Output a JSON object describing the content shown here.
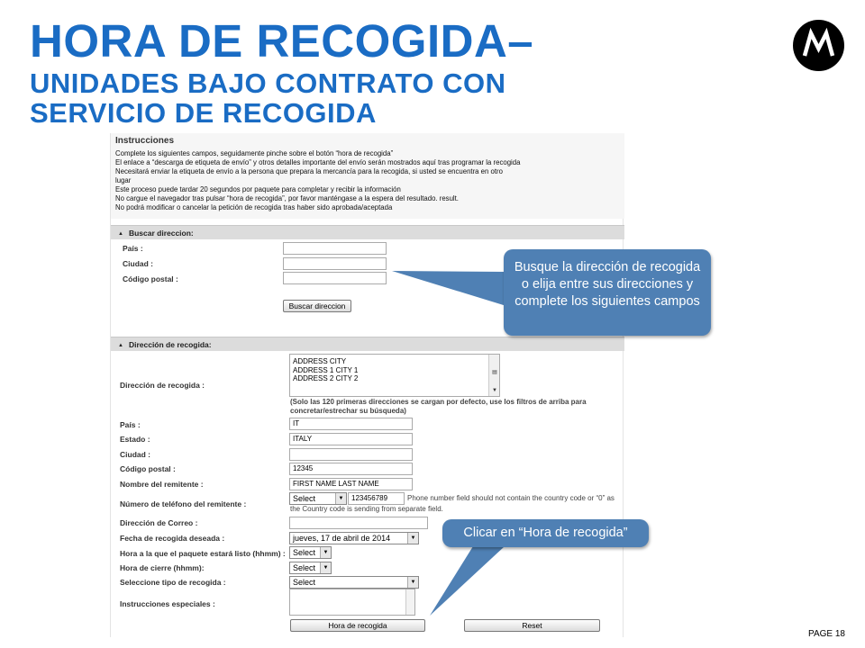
{
  "slide": {
    "title_main": "HORA DE RECOGIDA–",
    "title_sub_1": "UNIDADES BAJO CONTRATO CON",
    "title_sub_2": "SERVICIO DE RECOGIDA",
    "page_number": "PAGE 18"
  },
  "instructions": {
    "title": "Instrucciones",
    "lines": [
      "Complete los siguientes campos, seguidamente pinche sobre el botón “hora de recogida”",
      "El enlace a “descarga de etiqueta de envío” y otros detalles importante del envío serán mostrados aquí tras programar la recogida",
      "Necesitará enviar la etiqueta de envío a la persona que prepara la mercancía para la recogida, si usted se encuentra en otro",
      "lugar",
      "Este proceso puede tardar 20 segundos por paquete para completar y recibir la información",
      "No cargue el navegador tras pulsar “hora de recogida”, por favor manténgase a la espera del resultado. result.",
      "No podrá modificar o cancelar la petición de recogida tras haber sido aprobada/aceptada"
    ]
  },
  "buscar": {
    "header": "Buscar direccion:",
    "pais_label": "País :",
    "ciudad_label": "Ciudad :",
    "postal_label": "Código postal :",
    "button": "Buscar direccion"
  },
  "recogida": {
    "header": "Dirección de recogida:",
    "direccion_label": "Dirección de recogida :",
    "list_items": [
      "ADDRESS CITY",
      "ADDRESS 1 CITY 1",
      "ADDRESS 2 CITY 2"
    ],
    "list_note_1": "(Solo las 120 primeras direcciones se cargan por defecto, use los filtros de arriba para",
    "list_note_2": "concretar/estrechar su búsqueda)",
    "pais_label": "País :",
    "pais_value": "IT",
    "estado_label": "Estado :",
    "estado_value": "ITALY",
    "ciudad_label": "Ciudad :",
    "ciudad_value": "",
    "postal_label": "Código postal :",
    "postal_value": "12345",
    "remitente_label": "Nombre del remitente :",
    "remitente_value": "FIRST NAME LAST NAME",
    "telefono_label": "Número de teléfono del remitente :",
    "telefono_select": "Select",
    "telefono_value": "123456789",
    "telefono_hint_1": "Phone number field should not contain the country code or “0” as",
    "telefono_hint_2": "the Country code is sending from separate field.",
    "correo_label": "Dirección de Correo :",
    "correo_value": "",
    "fecha_label": "Fecha de recogida deseada :",
    "fecha_value": "jueves, 17 de abril de 2014",
    "hora_listo_label": "Hora a la que el paquete estará listo (hhmm) :",
    "hora_listo_value": "Select",
    "hora_cierre_label": "Hora de cierre (hhmm):",
    "hora_cierre_value": "Select",
    "tipo_label": "Seleccione tipo de recogida :",
    "tipo_value": "Select",
    "instrucciones_label": "Instrucciones especiales :",
    "hora_button": "Hora de recogida",
    "reset_button": "Reset"
  },
  "callouts": {
    "busque": "Busque la dirección de recogida o elija entre sus direcciones y complete los siguientes campos",
    "clicar": "Clicar en “Hora de recogida”"
  },
  "colors": {
    "title_blue": "#1a6cc4",
    "callout_blue": "#4f80b4"
  }
}
